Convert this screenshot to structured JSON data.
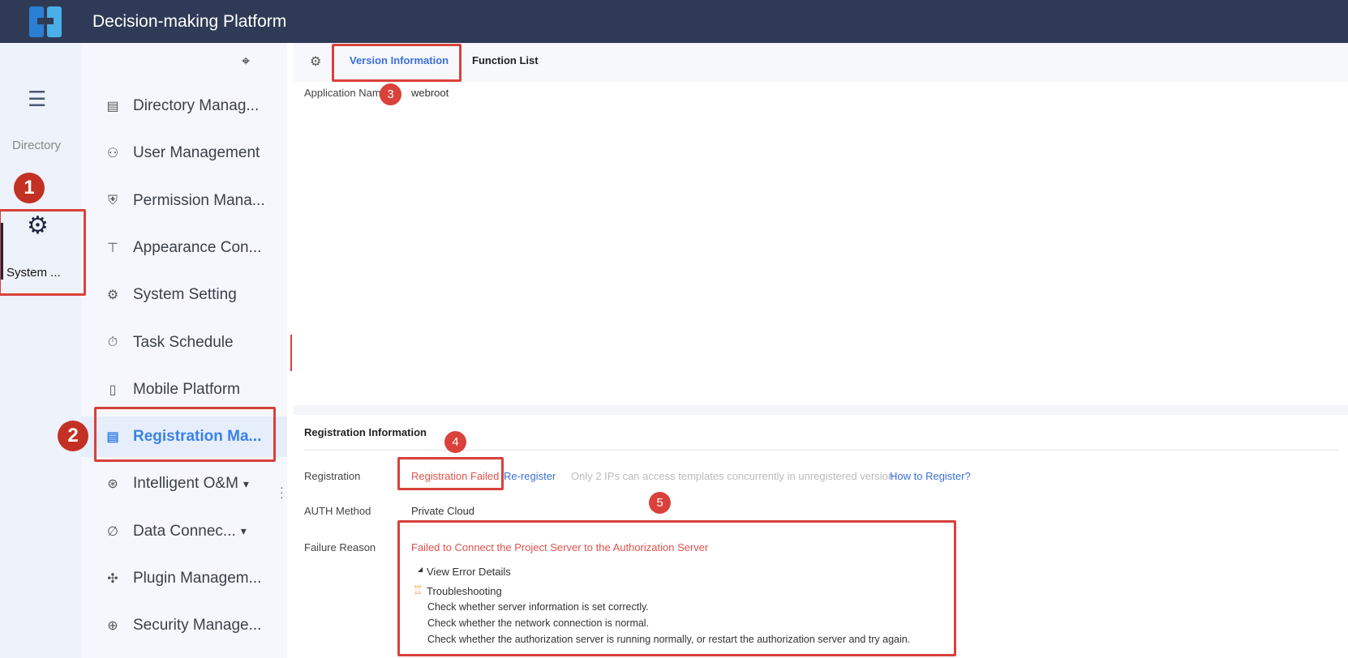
{
  "header": {
    "title": "Decision-making Platform"
  },
  "rail": {
    "directory_label": "Directory",
    "system_label": "System ..."
  },
  "sidebar": {
    "items": [
      {
        "label": "Directory Manag...",
        "icon": "list-doc-icon"
      },
      {
        "label": "User Management",
        "icon": "user-icon"
      },
      {
        "label": "Permission Mana...",
        "icon": "shield-key-icon"
      },
      {
        "label": "Appearance Con...",
        "icon": "paint-roller-icon"
      },
      {
        "label": "System Setting",
        "icon": "gear-icon"
      },
      {
        "label": "Task Schedule",
        "icon": "stopwatch-icon"
      },
      {
        "label": "Mobile Platform",
        "icon": "mobile-icon"
      },
      {
        "label": "Registration Ma...",
        "icon": "registration-icon",
        "active": true
      },
      {
        "label": "Intelligent O&M",
        "icon": "om-icon",
        "expandable": true
      },
      {
        "label": "Data Connec...",
        "icon": "paperclip-icon",
        "expandable": true
      },
      {
        "label": "Plugin Managem...",
        "icon": "puzzle-icon"
      },
      {
        "label": "Security Manage...",
        "icon": "shield-plus-icon"
      }
    ]
  },
  "tabs": {
    "version": "Version Information",
    "functions": "Function List"
  },
  "app": {
    "label": "Application Nam",
    "value": "webroot"
  },
  "registration": {
    "heading": "Registration Information",
    "reg_label": "Registration",
    "status": "Registration Failed",
    "reregister": "Re-register",
    "note": "Only 2 IPs can access templates concurrently in unregistered version",
    "how": "How to Register?",
    "auth_label": "AUTH Method",
    "auth_value": "Private Cloud",
    "failure_label": "Failure Reason",
    "failure": "Failed to Connect the Project Server to the Authorization Server",
    "view_details": "View Error Details",
    "troubleshooting": "Troubleshooting",
    "checks": [
      "Check whether server information is set correctly.",
      "Check whether the network connection is normal.",
      "Check whether the authorization server is running normally, or restart the authorization server and try again."
    ]
  },
  "badges": [
    "1",
    "2",
    "3",
    "4",
    "5"
  ],
  "colors": {
    "header": "#2f3b56",
    "accent": "#3b82e6",
    "error": "#e0514b",
    "annotation": "#d9413a"
  }
}
